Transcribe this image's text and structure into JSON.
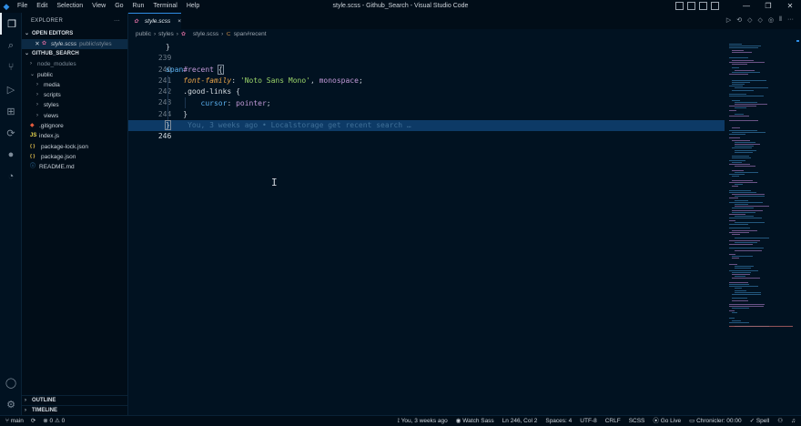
{
  "window": {
    "title": "style.scss - Github_Search - Visual Studio Code",
    "menu": [
      "File",
      "Edit",
      "Selection",
      "View",
      "Go",
      "Run",
      "Terminal",
      "Help"
    ]
  },
  "activity_icons": [
    "explorer-icon",
    "search-icon",
    "source-control-icon",
    "run-debug-icon",
    "extensions-icon",
    "remote-icon",
    "github-icon",
    "timeline-icon"
  ],
  "sidebar": {
    "title": "EXPLORER",
    "open_editors": {
      "header": "OPEN EDITORS",
      "items": [
        {
          "name": "style.scss",
          "path": "public\\styles"
        }
      ]
    },
    "project": {
      "header": "GITHUB_SEARCH",
      "tree": [
        {
          "label": "node_modules",
          "type": "folder",
          "depth": 1,
          "expanded": false
        },
        {
          "label": "public",
          "type": "folder",
          "depth": 1,
          "expanded": true
        },
        {
          "label": "media",
          "type": "folder",
          "depth": 2,
          "expanded": false
        },
        {
          "label": "scripts",
          "type": "folder",
          "depth": 2,
          "expanded": false
        },
        {
          "label": "styles",
          "type": "folder",
          "depth": 2,
          "expanded": false
        },
        {
          "label": "views",
          "type": "folder",
          "depth": 2,
          "expanded": false
        },
        {
          "label": ".gitignore",
          "type": "git",
          "depth": 1
        },
        {
          "label": "index.js",
          "type": "js",
          "depth": 1
        },
        {
          "label": "package-lock.json",
          "type": "json",
          "depth": 1
        },
        {
          "label": "package.json",
          "type": "json",
          "depth": 1
        },
        {
          "label": "README.md",
          "type": "md",
          "depth": 1
        }
      ]
    },
    "outline": "OUTLINE",
    "timeline": "TIMELINE"
  },
  "tab": {
    "label": "style.scss",
    "close": "×"
  },
  "breadcrumbs": [
    "public",
    "styles",
    "style.scss",
    "span#recent"
  ],
  "editor": {
    "lines": [
      {
        "num": "239",
        "text": "}"
      },
      {
        "num": "240",
        "text": ""
      },
      {
        "num": "241",
        "text": "span#recent {"
      },
      {
        "num": "242",
        "text": "    font-family: 'Noto Sans Mono', monospace;"
      },
      {
        "num": "243",
        "text": "    .good-links {"
      },
      {
        "num": "244",
        "text": "        cursor: pointer;"
      },
      {
        "num": "245",
        "text": "    }"
      },
      {
        "num": "246",
        "text": "}"
      }
    ],
    "blame": "You, 3 weeks ago • Localstorage get recent search …"
  },
  "statusbar": {
    "branch": "main",
    "problems": "⊗ 0 ⚠ 0",
    "blame": "You, 3 weeks ago",
    "watch_sass": "Watch Sass",
    "position": "Ln 246, Col 2",
    "spaces": "Spaces: 4",
    "encoding": "UTF-8",
    "eol": "CRLF",
    "language": "SCSS",
    "golive": "Go Live",
    "chronicler": "Chronicler: 00:00",
    "spell": "Spell"
  },
  "colors": {
    "accent": "#2f8de4",
    "editor_bg": "#011221",
    "sidebar_bg": "#010d18",
    "line_highlight": "#0d3a66"
  }
}
